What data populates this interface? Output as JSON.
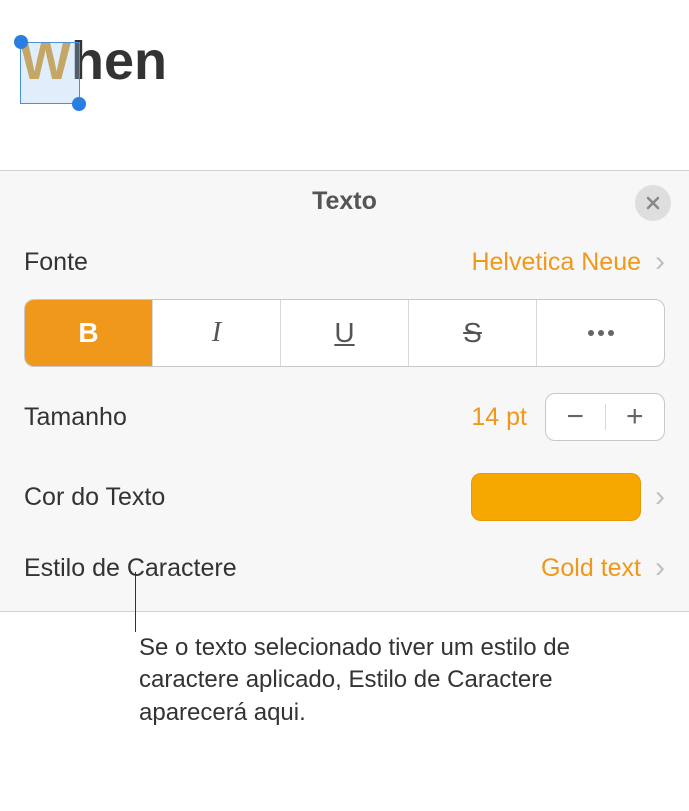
{
  "preview": {
    "selected_char": "W",
    "rest_text": "hen"
  },
  "panel": {
    "title": "Texto",
    "font": {
      "label": "Fonte",
      "value": "Helvetica Neue"
    },
    "size": {
      "label": "Tamanho",
      "value": "14 pt"
    },
    "text_color": {
      "label": "Cor do Texto",
      "swatch_hex": "#f7a800"
    },
    "char_style": {
      "label": "Estilo de Caractere",
      "value": "Gold text"
    },
    "format_buttons": {
      "bold": "B",
      "italic": "I",
      "underline": "U",
      "strike": "S"
    }
  },
  "callout": {
    "text": "Se o texto selecionado tiver um estilo de caractere aplicado, Estilo de Caractere aparecerá aqui."
  }
}
